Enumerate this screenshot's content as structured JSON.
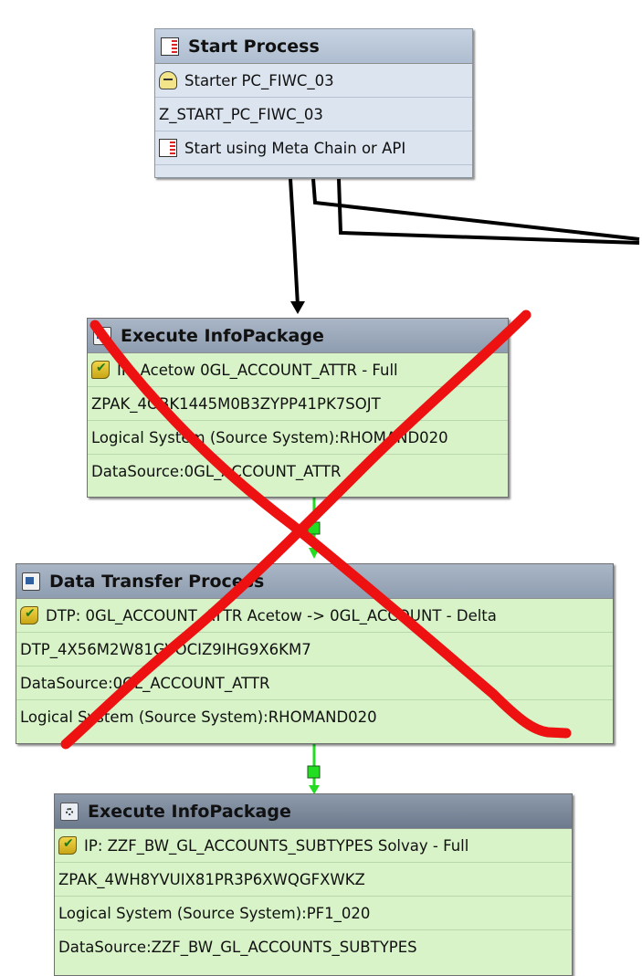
{
  "nodes": {
    "start": {
      "title": "Start Process",
      "rows": [
        "Starter PC_FIWC_03",
        "Z_START_PC_FIWC_03",
        "Start using Meta Chain or API"
      ]
    },
    "infopackage1": {
      "title": "Execute InfoPackage",
      "rows": [
        "IP: Acetow 0GL_ACCOUNT_ATTR - Full",
        "ZPAK_4OBK1445M0B3ZYPP41PK7SOJT",
        "Logical System (Source System):RHOMAND020",
        "DataSource:0GL_ACCOUNT_ATTR"
      ]
    },
    "dtp": {
      "title": "Data Transfer Process",
      "rows": [
        "DTP: 0GL_ACCOUNT_ATTR Acetow -> 0GL_ACCOUNT - Delta",
        "DTP_4X56M2W81GVOCIZ9IHG9X6KM7",
        "DataSource:0GL_ACCOUNT_ATTR",
        "Logical System (Source System):RHOMAND020"
      ]
    },
    "infopackage2": {
      "title": "Execute InfoPackage",
      "rows": [
        "IP: ZZF_BW_GL_ACCOUNTS_SUBTYPES Solvay - Full",
        "ZPAK_4WH8YVUIX81PR3P6XWQGFXWKZ",
        "Logical System (Source System):PF1_020",
        "DataSource:ZZF_BW_GL_ACCOUNTS_SUBTYPES"
      ]
    }
  },
  "colors": {
    "node_body": "#d7f3c7",
    "start_body": "#dbe4ef",
    "header_slate": "#8e9db0",
    "connector_green": "#22dd22",
    "connector_black": "#000000",
    "annotation_red": "#ee1111"
  },
  "icons": {
    "start_header": "process-chain-start-icon",
    "starter": "starter-variant-icon",
    "meta": "meta-chain-icon",
    "infopackage": "infopackage-icon",
    "dtp": "dtp-icon",
    "check": "status-check-icon"
  }
}
